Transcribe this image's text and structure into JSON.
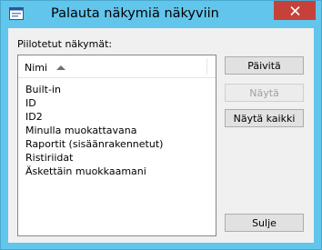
{
  "window": {
    "title": "Palauta näkymiä näkyviin",
    "close_label": "✕"
  },
  "group": {
    "label": "Piilotetut näkymät:"
  },
  "list": {
    "column_header": "Nimi",
    "sort_direction": "ascending",
    "items": [
      {
        "label": "Built-in"
      },
      {
        "label": "ID"
      },
      {
        "label": "ID2"
      },
      {
        "label": "Minulla muokattavana"
      },
      {
        "label": "Raportit (sisäänrakennetut)"
      },
      {
        "label": "Ristiriidat"
      },
      {
        "label": "Äskettäin muokkaamani"
      }
    ]
  },
  "buttons": {
    "refresh": "Päivitä",
    "show": "Näytä",
    "show_all": "Näytä kaikki",
    "close": "Sulje"
  },
  "colors": {
    "frame": "#62c5ec",
    "close_button": "#c7413b",
    "client_background": "#f0f0f0"
  }
}
